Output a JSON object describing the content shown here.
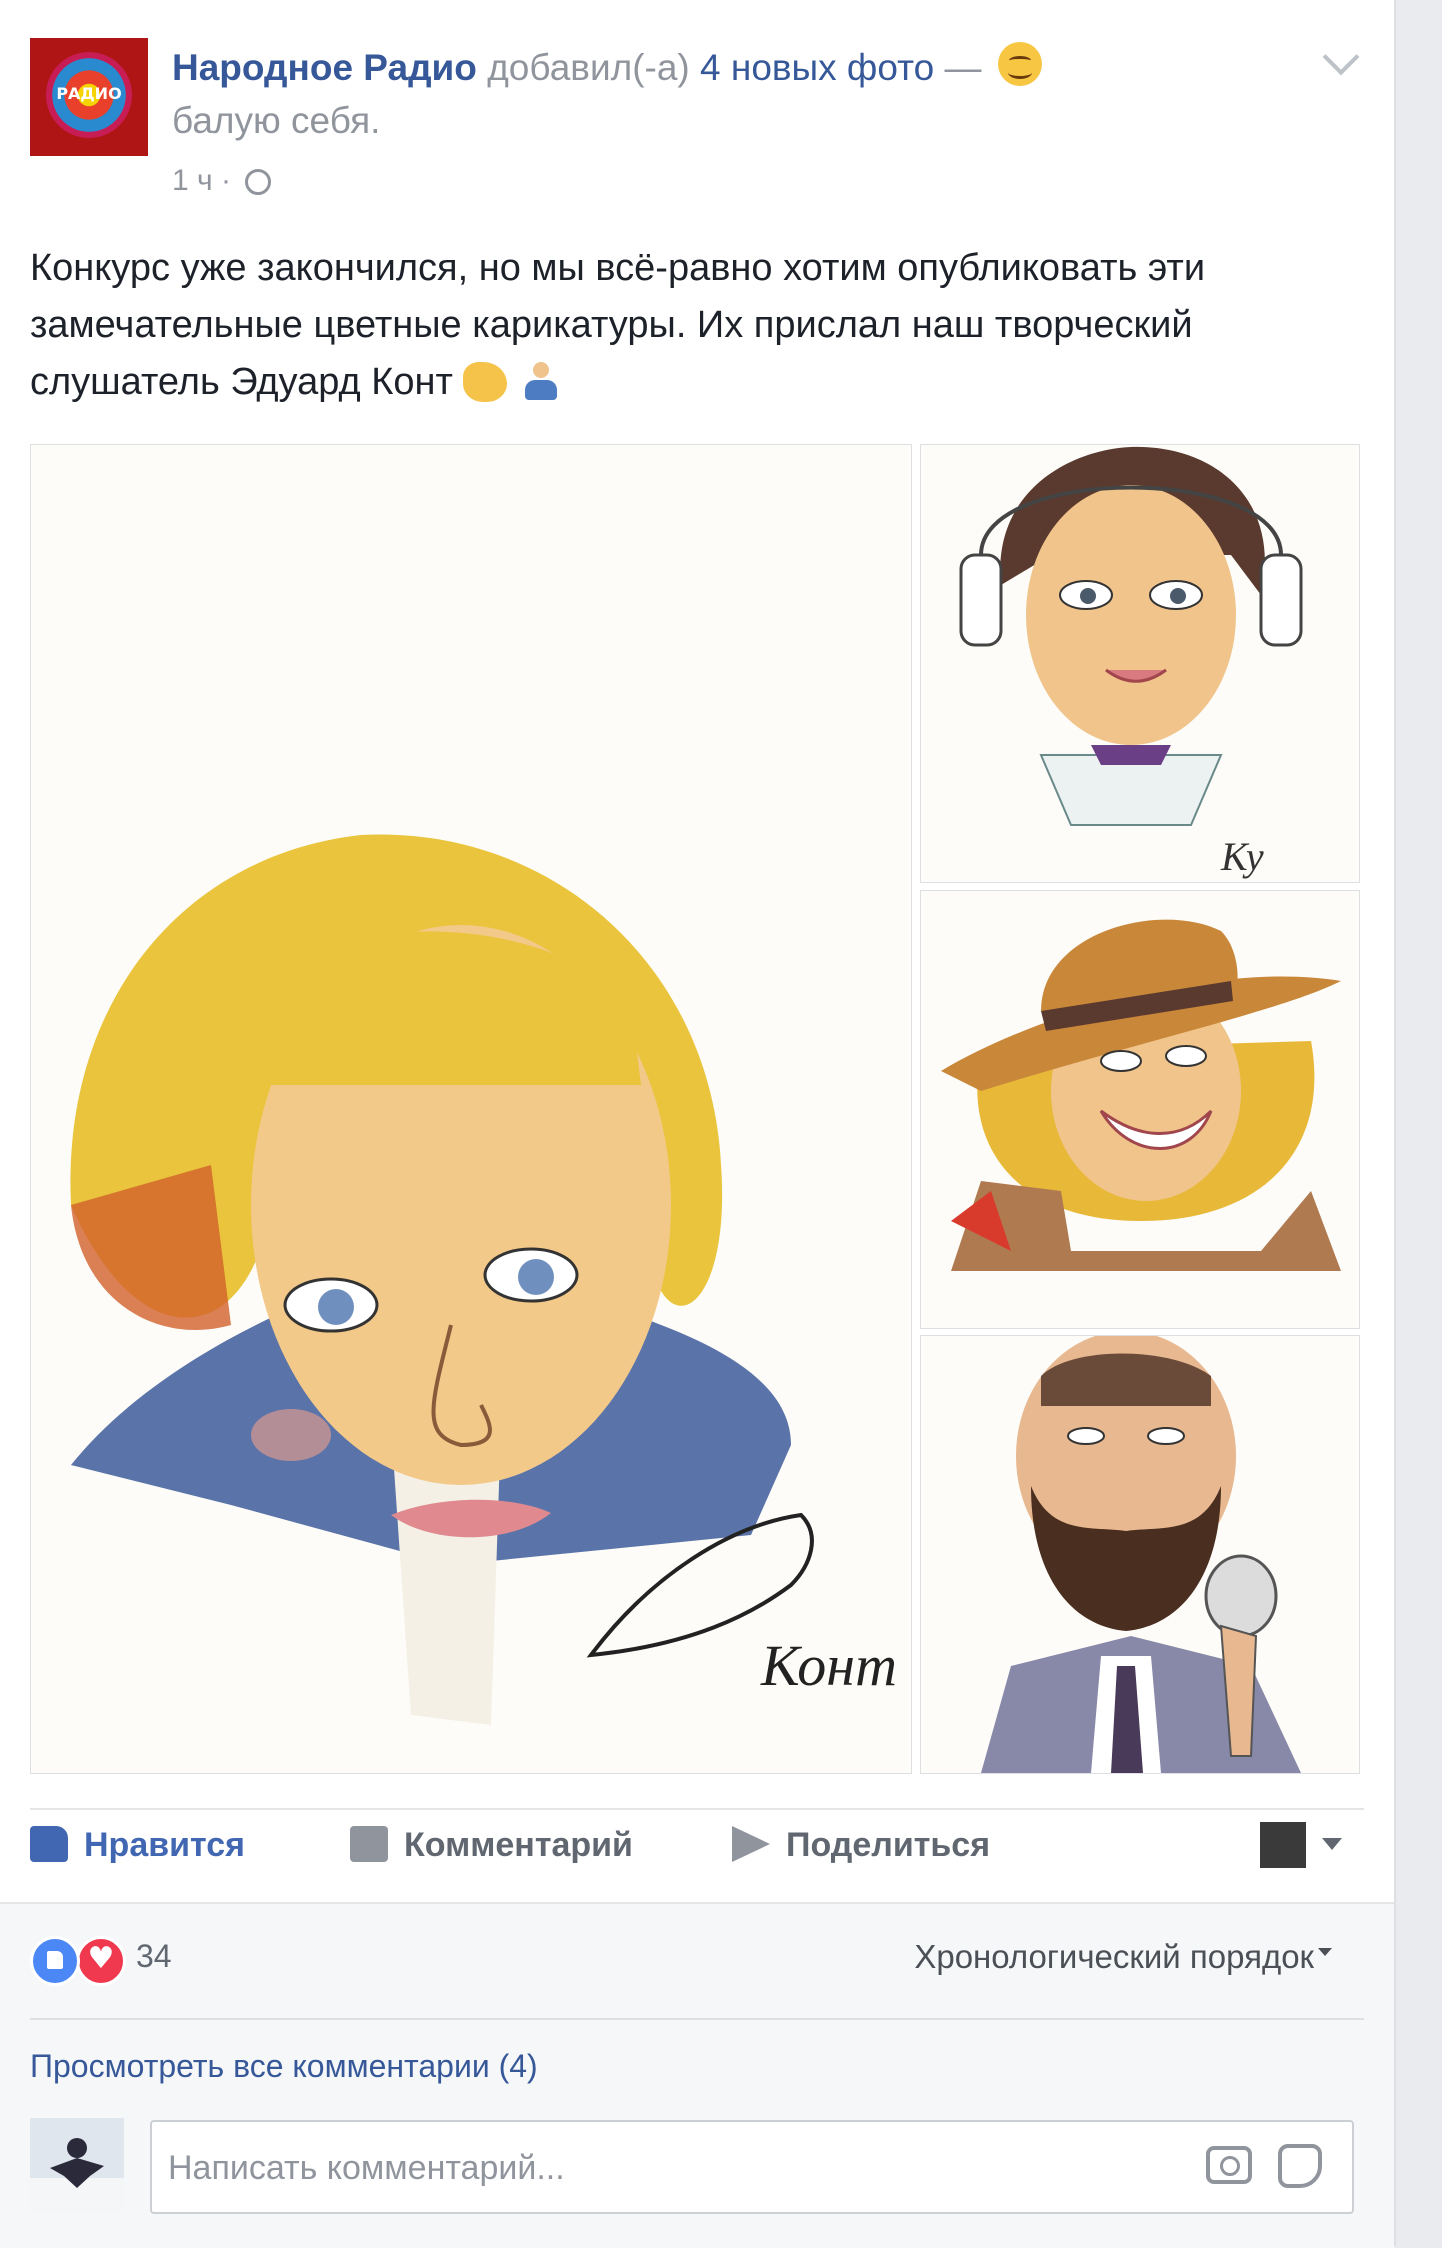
{
  "post": {
    "page_name": "Народное Радио",
    "action_text": " добавил(-а) ",
    "photos_link": "4 новых фото",
    "feeling_dash": " — ",
    "feeling_text": "балую себя.",
    "time": "1 ч",
    "time_sep": " · ",
    "avatar_logo_text": "РАДИО",
    "body_lines": [
      "Конкурс уже закончился, но мы всё-равно хотим опубликовать эти",
      "замечательные цветные карикатуры. Их прислал наш творческий",
      "слушатель Эдуард Конт"
    ],
    "body_emojis": [
      "pointing-hand-emoji",
      "person-emoji"
    ],
    "images": [
      {
        "name": "caricature-woman-blonde-bob",
        "signature": "Конт"
      },
      {
        "name": "caricature-woman-headphones"
      },
      {
        "name": "caricature-woman-hat"
      },
      {
        "name": "caricature-man-beard-microphone"
      }
    ]
  },
  "actions": {
    "like": "Нравится",
    "comment": "Комментарий",
    "share": "Поделиться"
  },
  "reactions": {
    "count": "34",
    "types": [
      "like",
      "love"
    ],
    "order_label": "Хронологический порядок"
  },
  "comments": {
    "view_all": "Просмотреть все комментарии (4)",
    "placeholder": "Написать комментарий..."
  },
  "colors": {
    "link": "#365899",
    "like_blue": "#4267b2",
    "secondary_text": "#90949c",
    "love_red": "#f0384f"
  }
}
